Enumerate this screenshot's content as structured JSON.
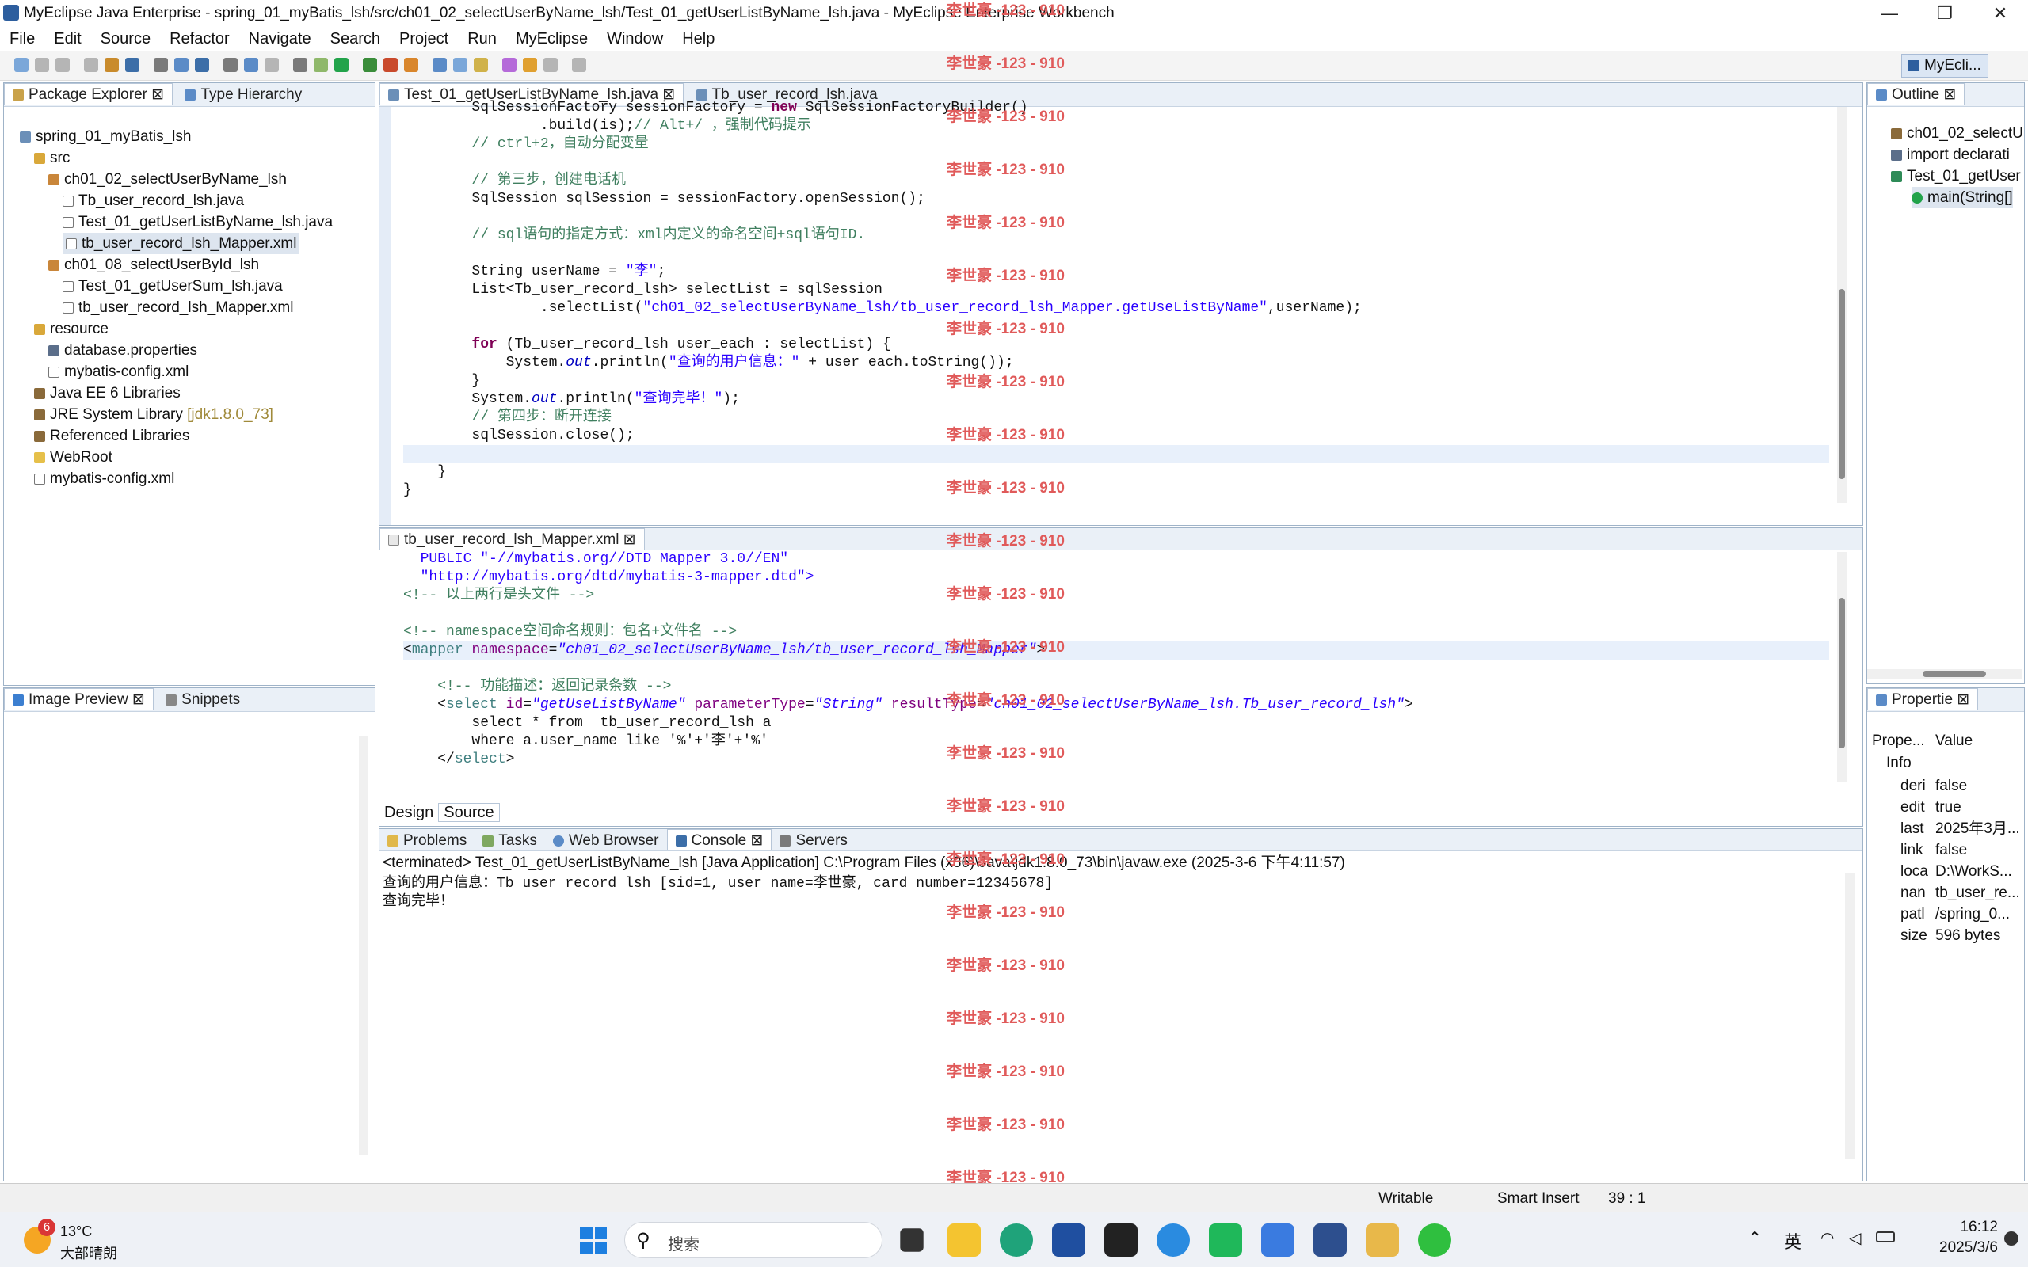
{
  "window": {
    "title": "MyEclipse Java Enterprise - spring_01_myBatis_lsh/src/ch01_02_selectUserByName_lsh/Test_01_getUserListByName_lsh.java - MyEclipse Enterprise Workbench",
    "minimize": "—",
    "maximize": "❐",
    "close": "✕"
  },
  "menu": [
    "File",
    "Edit",
    "Source",
    "Refactor",
    "Navigate",
    "Search",
    "Project",
    "Run",
    "MyEclipse",
    "Window",
    "Help"
  ],
  "perspective": "MyEcli...",
  "package_explorer": {
    "tabs": [
      "Package Explorer",
      "Type Hierarchy"
    ],
    "items": [
      {
        "label": "spring_01_myBatis_lsh",
        "depth": 0,
        "icon": "project-icon"
      },
      {
        "label": "src",
        "depth": 1,
        "icon": "source-folder-icon"
      },
      {
        "label": "ch01_02_selectUserByName_lsh",
        "depth": 2,
        "icon": "package-icon"
      },
      {
        "label": "Tb_user_record_lsh.java",
        "depth": 3,
        "icon": "java-file-icon"
      },
      {
        "label": "Test_01_getUserListByName_lsh.java",
        "depth": 3,
        "icon": "java-file-icon"
      },
      {
        "label": "tb_user_record_lsh_Mapper.xml",
        "depth": 3,
        "icon": "xml-file-icon",
        "selected": true
      },
      {
        "label": "ch01_08_selectUserById_lsh",
        "depth": 2,
        "icon": "package-icon"
      },
      {
        "label": "Test_01_getUserSum_lsh.java",
        "depth": 3,
        "icon": "java-file-icon"
      },
      {
        "label": "tb_user_record_lsh_Mapper.xml",
        "depth": 3,
        "icon": "xml-file-icon"
      },
      {
        "label": "resource",
        "depth": 1,
        "icon": "source-folder-icon"
      },
      {
        "label": "database.properties",
        "depth": 2,
        "icon": "properties-file-icon"
      },
      {
        "label": "mybatis-config.xml",
        "depth": 2,
        "icon": "xml-file-icon"
      },
      {
        "label": "Java EE 6 Libraries",
        "depth": 1,
        "icon": "library-icon"
      },
      {
        "label": "JRE System Library",
        "suffix": "[jdk1.8.0_73]",
        "depth": 1,
        "icon": "library-icon"
      },
      {
        "label": "Referenced Libraries",
        "depth": 1,
        "icon": "library-icon"
      },
      {
        "label": "WebRoot",
        "depth": 1,
        "icon": "folder-icon"
      },
      {
        "label": "mybatis-config.xml",
        "depth": 1,
        "icon": "xml-file-icon"
      }
    ]
  },
  "image_preview": {
    "tabs": [
      "Image Preview",
      "Snippets"
    ]
  },
  "editor_java": {
    "tabs": [
      "Test_01_getUserListByName_lsh.java",
      "Tb_user_record_lsh.java"
    ],
    "lines": [
      "        SqlSessionFactory sessionFactory = new SqlSessionFactoryBuilder()",
      "                .build(is);// Alt+/ ，强制代码提示",
      "        // ctrl+2，自动分配变量",
      "",
      "        // 第三步，创建电话机",
      "        SqlSession sqlSession = sessionFactory.openSession();",
      "",
      "        // sql语句的指定方式：xml内定义的命名空间+sql语句ID.",
      "",
      "        String userName = \"李\";",
      "        List<Tb_user_record_lsh> selectList = sqlSession",
      "                .selectList(\"ch01_02_selectUserByName_lsh/tb_user_record_lsh_Mapper.getUseListByName\",userName);",
      "",
      "        for (Tb_user_record_lsh user_each : selectList) {",
      "            System.out.println(\"查询的用户信息：\" + user_each.toString());",
      "        }",
      "        System.out.println(\"查询完毕！\");",
      "        // 第四步：断开连接",
      "        sqlSession.close();",
      "",
      "    }",
      "}"
    ]
  },
  "editor_xml": {
    "tabs": [
      "tb_user_record_lsh_Mapper.xml"
    ],
    "lines": [
      "  PUBLIC \"-//mybatis.org//DTD Mapper 3.0//EN\"",
      "  \"http://mybatis.org/dtd/mybatis-3-mapper.dtd\">",
      "<!-- 以上两行是头文件 -->",
      "",
      "<!-- namespace空间命名规则：包名+文件名 -->",
      "<mapper namespace=\"ch01_02_selectUserByName_lsh/tb_user_record_lsh_Mapper\">",
      "",
      "    <!-- 功能描述：返回记录条数 -->",
      "    <select id=\"getUseListByName\" parameterType=\"String\" resultType=\"ch01_02_selectUserByName_lsh.Tb_user_record_lsh\">",
      "        select * from  tb_user_record_lsh a",
      "        where a.user_name like '%'+'李'+'%'",
      "    </select>"
    ],
    "bottom_tabs": [
      "Design",
      "Source"
    ]
  },
  "console": {
    "tabs": [
      "Problems",
      "Tasks",
      "Web Browser",
      "Console",
      "Servers"
    ],
    "header": "<terminated> Test_01_getUserListByName_lsh [Java Application] C:\\Program Files (x86)\\Java\\jdk1.8.0_73\\bin\\javaw.exe (2025-3-6 下午4:11:57)",
    "output": [
      "查询的用户信息：Tb_user_record_lsh [sid=1, user_name=李世豪, card_number=12345678]",
      "查询完毕！"
    ]
  },
  "outline": {
    "tabs": [
      "Outline"
    ],
    "items": [
      "ch01_02_selectU",
      "import declarati",
      "Test_01_getUser",
      "main(String[]"
    ]
  },
  "properties": {
    "tabs": [
      "Propertie"
    ],
    "headers": [
      "Prope...",
      "Value"
    ],
    "group": "Info",
    "rows": [
      {
        "k": "deri",
        "v": "false"
      },
      {
        "k": "edit",
        "v": "true"
      },
      {
        "k": "last",
        "v": "2025年3月..."
      },
      {
        "k": "link",
        "v": "false"
      },
      {
        "k": "loca",
        "v": "D:\\WorkS..."
      },
      {
        "k": "nan",
        "v": "tb_user_re..."
      },
      {
        "k": "patl",
        "v": "/spring_0..."
      },
      {
        "k": "size",
        "v": "596  bytes"
      }
    ]
  },
  "statusbar": {
    "writable": "Writable",
    "insert": "Smart Insert",
    "position": "39 : 1"
  },
  "watermark": "李世豪 -123 - 910",
  "taskbar": {
    "weather_temp": "13°C",
    "weather_desc": "大部晴朗",
    "weather_badge": "6",
    "search_placeholder": "搜索",
    "ime": "英",
    "time": "16:12",
    "date": "2025/3/6"
  },
  "colors": {
    "accent": "#3c7fd0",
    "watermark": "#e05a5a",
    "keyword": "#7f0055",
    "string": "#2a00ff",
    "comment": "#3f7f5f"
  }
}
